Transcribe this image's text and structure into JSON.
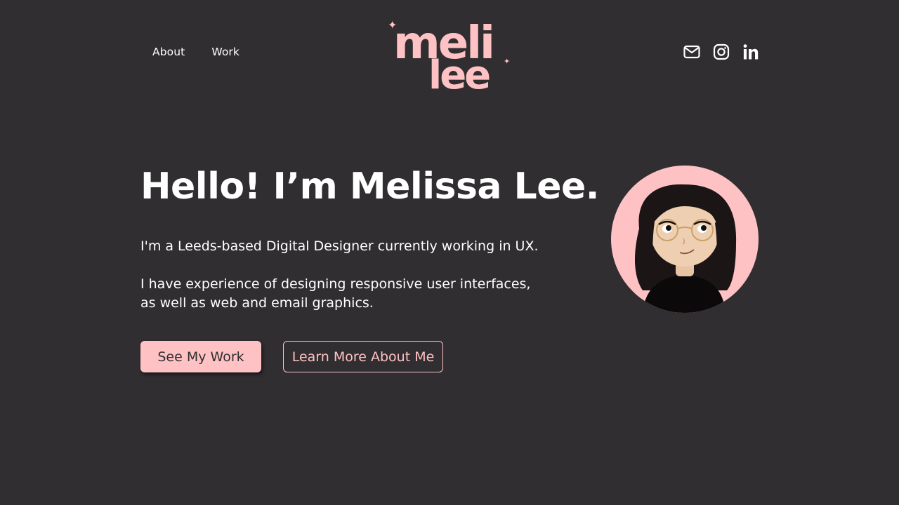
{
  "nav": {
    "about": "About",
    "work": "Work"
  },
  "logo": {
    "line1": "meli",
    "line2": "lee"
  },
  "socials": [
    {
      "name": "email-icon"
    },
    {
      "name": "instagram-icon"
    },
    {
      "name": "linkedin-icon"
    }
  ],
  "hero": {
    "title": "Hello! I’m Melissa Lee.",
    "intro": "I'm a Leeds-based Digital Designer currently working in UX.",
    "experience": "I have experience of designing responsive user interfaces, as well as web and email graphics.",
    "primary_button": "See My Work",
    "secondary_button": "Learn More About Me"
  },
  "colors": {
    "background": "#302e30",
    "accent": "#ffc2c4",
    "text": "#ffffff"
  }
}
